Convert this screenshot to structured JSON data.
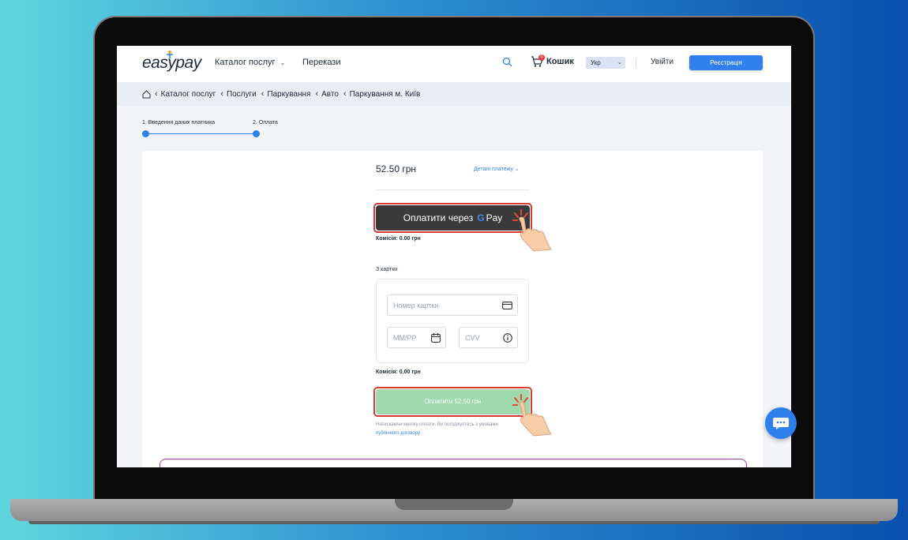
{
  "header": {
    "logo_text": "easypay",
    "nav": [
      {
        "label": "Каталог послуг",
        "has_dropdown": true
      },
      {
        "label": "Перекази",
        "has_dropdown": false
      }
    ],
    "cart_label": "Кошик",
    "cart_count": "0",
    "language": "Укр",
    "login_label": "Увійти",
    "register_label": "Реєстрація"
  },
  "breadcrumb": [
    "Каталог послуг",
    "Послуги",
    "Паркування",
    "Авто",
    "Паркування м. Київ"
  ],
  "steps": [
    {
      "label": "1. Введення даних платника"
    },
    {
      "label": "2. Оплата"
    }
  ],
  "payment": {
    "amount": "52.50 грн",
    "details_label": "Деталі платежу",
    "gpay_label": "Оплатити через",
    "gpay_brand": "Pay",
    "commission_gpay": "Комісія: 0.00 грн",
    "from_card_label": "З картки",
    "card_number_placeholder": "Номер картки",
    "expiry_placeholder": "ММ/РР",
    "cvv_placeholder": "CVV",
    "commission_card": "Комісія: 0.00 грн",
    "pay_button_label": "Оплатити 52.50 грн",
    "terms_text": "Натискаючи кнопку оплати, Ви погоджуєтесь з умовами",
    "terms_link": "публічного договору"
  },
  "colors": {
    "accent": "#2f80ed",
    "highlight": "#d93a34",
    "gpay_bg": "#3a3a3a",
    "pay_bg": "#a0d9ae"
  },
  "icons": [
    "home-icon",
    "search-icon",
    "cart-icon",
    "card-icon",
    "calendar-icon",
    "info-icon",
    "chat-icon",
    "chevron-down-icon"
  ]
}
